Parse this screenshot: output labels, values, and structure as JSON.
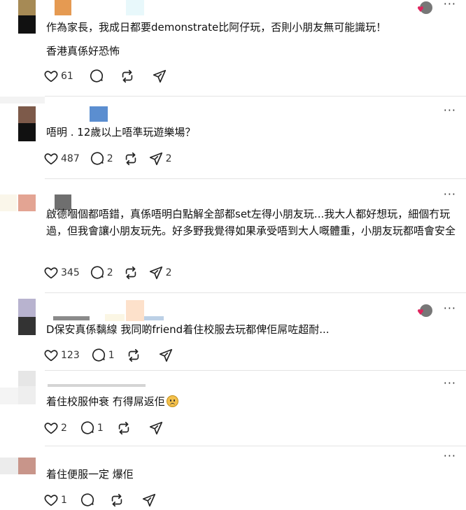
{
  "colors": {
    "accent_heart": "#e0245e",
    "divider": "#e4e4e4",
    "text": "#101010"
  },
  "icons": {
    "like": "heart-icon",
    "reply": "comment-bubble-icon",
    "repost": "repost-icon",
    "share": "send-icon",
    "more": "more-horizontal-icon"
  },
  "posts": [
    {
      "lines": [
        "作為家長，我成日都要demonstrate比阿仔玩，否則小朋友無可能識玩！",
        "香港真係好恐怖"
      ],
      "likes": "61",
      "replies": "",
      "reposts": "",
      "shares": "",
      "author_liked": true
    },
    {
      "lines": [
        "唔明 . 12歲以上唔準玩遊樂場？"
      ],
      "likes": "487",
      "replies": "2",
      "reposts": "",
      "shares": "2",
      "author_liked": false
    },
    {
      "lines": [
        "啟德嗰個都唔錯，真係唔明白點解全部都set左得小朋友玩...我大人都好想玩，細個冇玩過，但我會讓小朋友玩先。好多野我覺得如果承受唔到大人嘅體重，小朋友玩都唔會安全"
      ],
      "likes": "345",
      "replies": "2",
      "reposts": "",
      "shares": "2",
      "author_liked": false
    },
    {
      "lines": [
        "D保安真係黐線 我同啲friend着住校服去玩都俾佢屌咗超耐..."
      ],
      "likes": "123",
      "replies": "1",
      "reposts": "",
      "shares": "",
      "author_liked": true
    },
    {
      "lines": [
        "着住校服仲衰 冇得屌返佢"
      ],
      "likes": "2",
      "replies": "1",
      "reposts": "",
      "shares": "",
      "author_liked": false
    },
    {
      "lines": [
        "着住便服一定 爆佢"
      ],
      "likes": "1",
      "replies": "",
      "reposts": "",
      "shares": "",
      "author_liked": false
    }
  ]
}
